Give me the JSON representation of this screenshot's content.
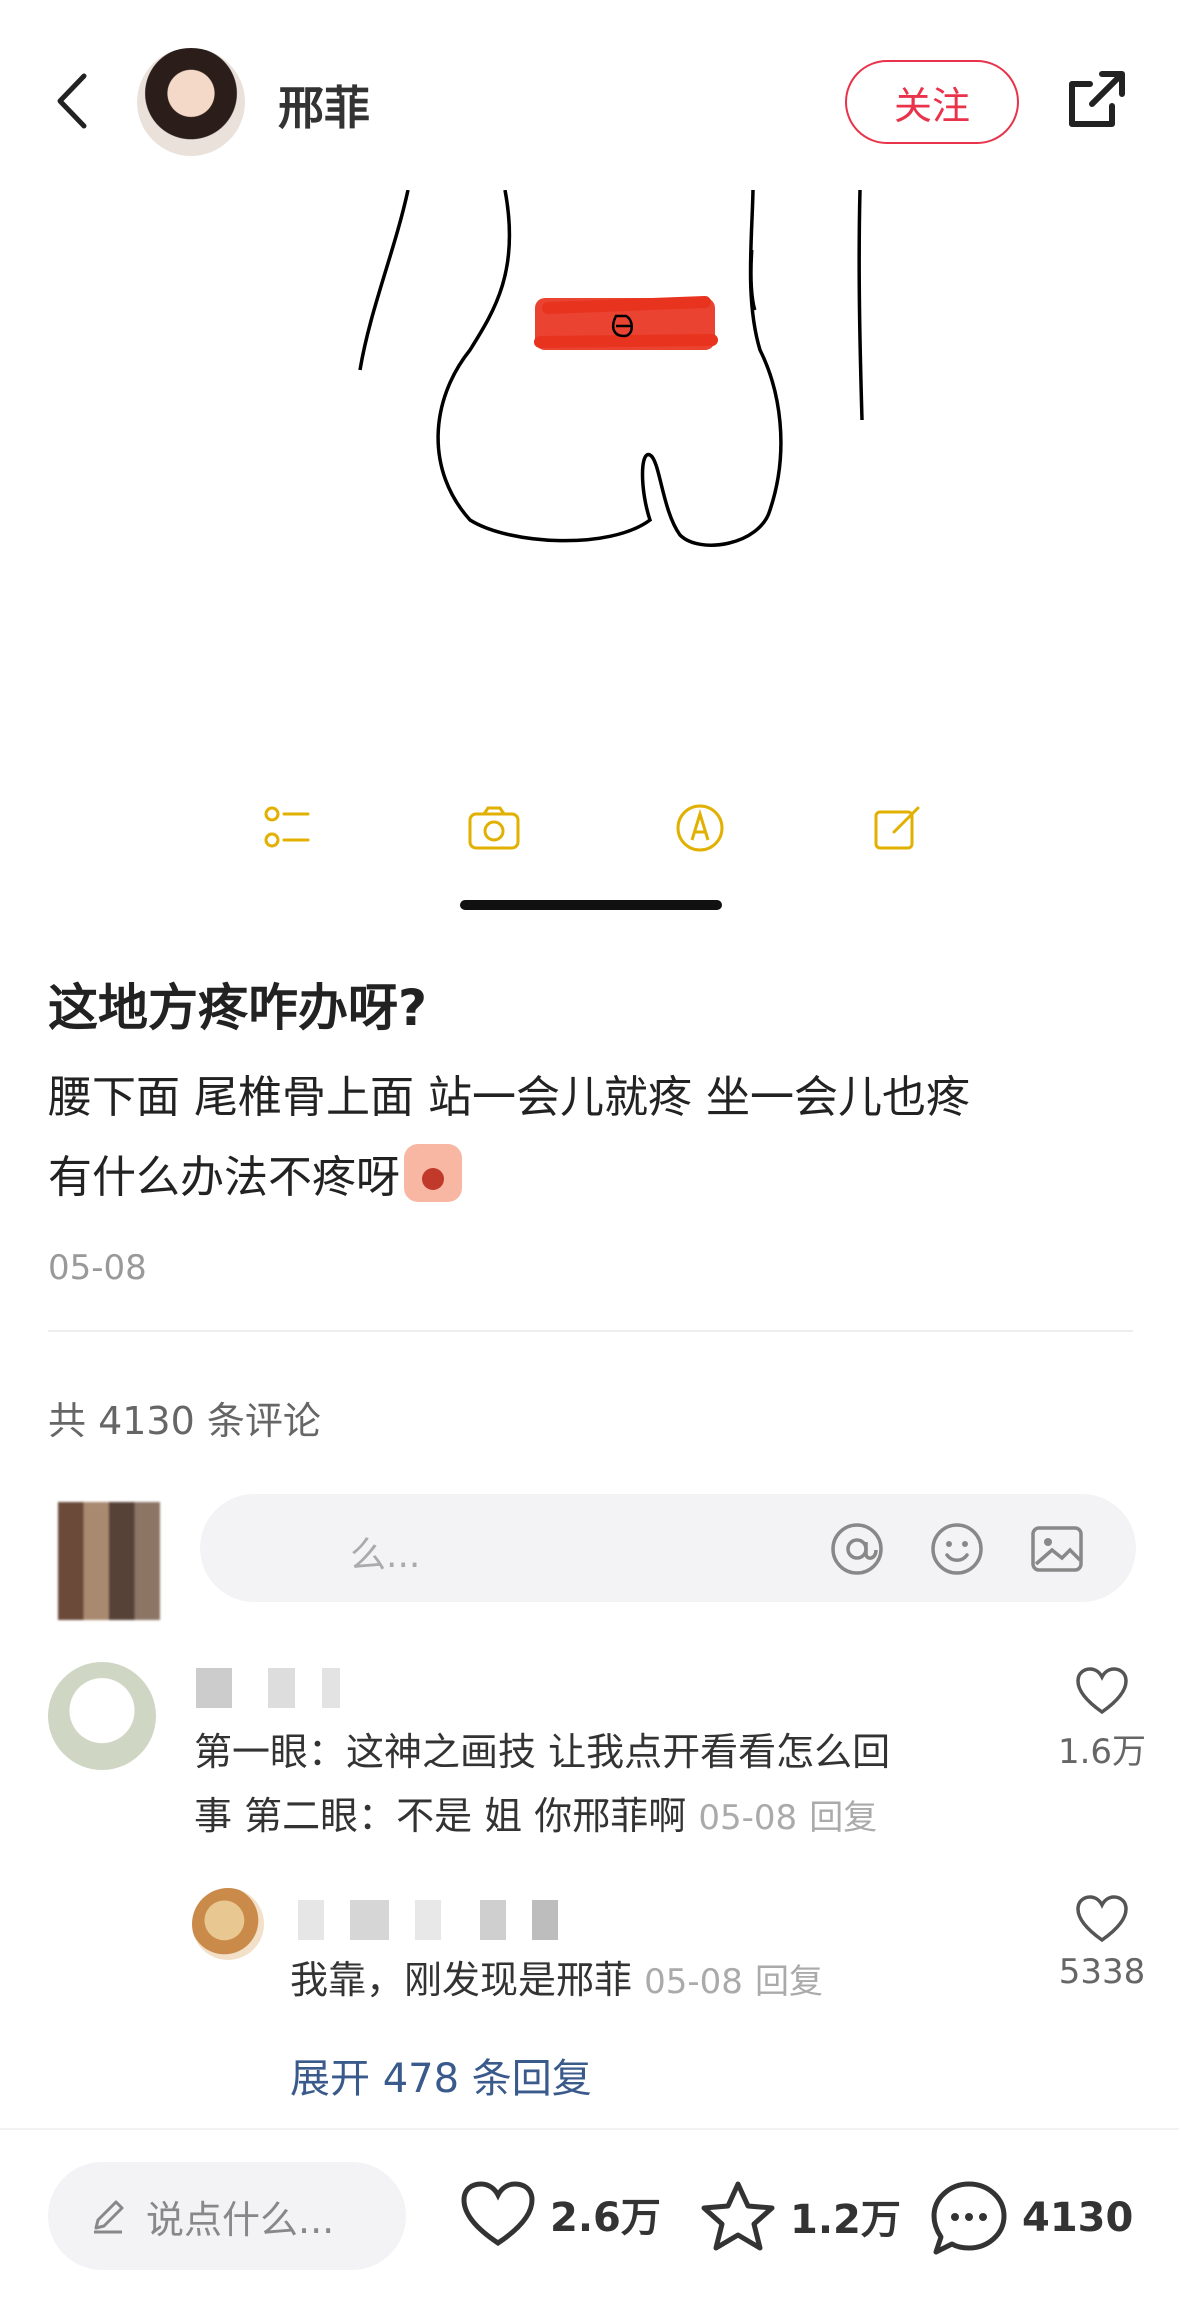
{
  "header": {
    "author_name": "邢菲",
    "follow_label": "关注"
  },
  "post": {
    "title": "这地方疼咋办呀?",
    "body_line1": "腰下面 尾椎骨上面 站一会儿就疼 坐一会儿也疼",
    "body_line2": "有什么办法不疼呀",
    "date": "05-08",
    "toolbar_icons": [
      "checklist-icon",
      "camera-icon",
      "markup-icon",
      "compose-icon"
    ]
  },
  "comments_section": {
    "count_label": "共 4130 条评论",
    "input_placeholder": "说点什么...",
    "input_placeholder_visible": "么...",
    "input_icons": [
      "at-icon",
      "emoji-icon",
      "image-icon"
    ],
    "comments": [
      {
        "text_line1": "第一眼：这神之画技 让我点开看看怎么回",
        "text_line2": "事  第二眼：不是 姐 你邢菲啊",
        "date": "05-08",
        "reply_label": "回复",
        "likes": "1.6万"
      }
    ],
    "reply": {
      "text": "我靠，刚发现是邢菲",
      "date": "05-08",
      "reply_label": "回复",
      "likes": "5338"
    },
    "expand_label": "展开 478 条回复"
  },
  "bottom_bar": {
    "input_placeholder": "说点什么...",
    "likes": "2.6万",
    "favorites": "1.2万",
    "comments": "4130"
  },
  "colors": {
    "accent_red": "#e8334a",
    "toolbar_gold": "#e2b000",
    "link_blue": "#3a5a8c"
  }
}
